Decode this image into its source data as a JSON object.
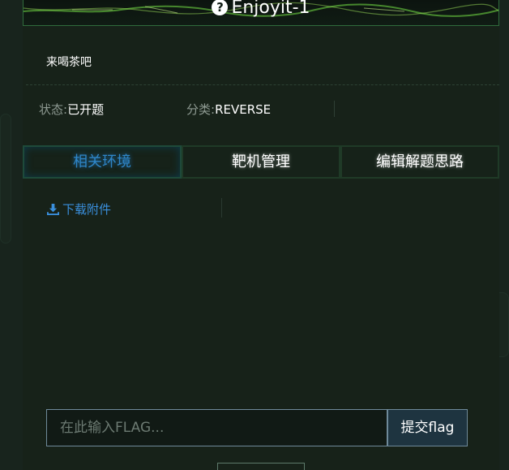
{
  "challenge": {
    "title": "Enjoyit-1",
    "description": "来喝茶吧",
    "status_label": "状态:",
    "status_value": "已开题",
    "category_label": "分类:",
    "category_value": "REVERSE"
  },
  "tabs": [
    {
      "label": "相关环境",
      "active": true
    },
    {
      "label": "靶机管理",
      "active": false
    },
    {
      "label": "编辑解题思路",
      "active": false
    }
  ],
  "attachment": {
    "label": "下载附件",
    "icon": "download-icon"
  },
  "flag_form": {
    "placeholder": "在此输入FLAG...",
    "value": "",
    "submit_label": "提交flag"
  },
  "colors": {
    "accent_blue": "#2f86c8",
    "title_border": "#2f6b3c",
    "background": "#18241d"
  }
}
